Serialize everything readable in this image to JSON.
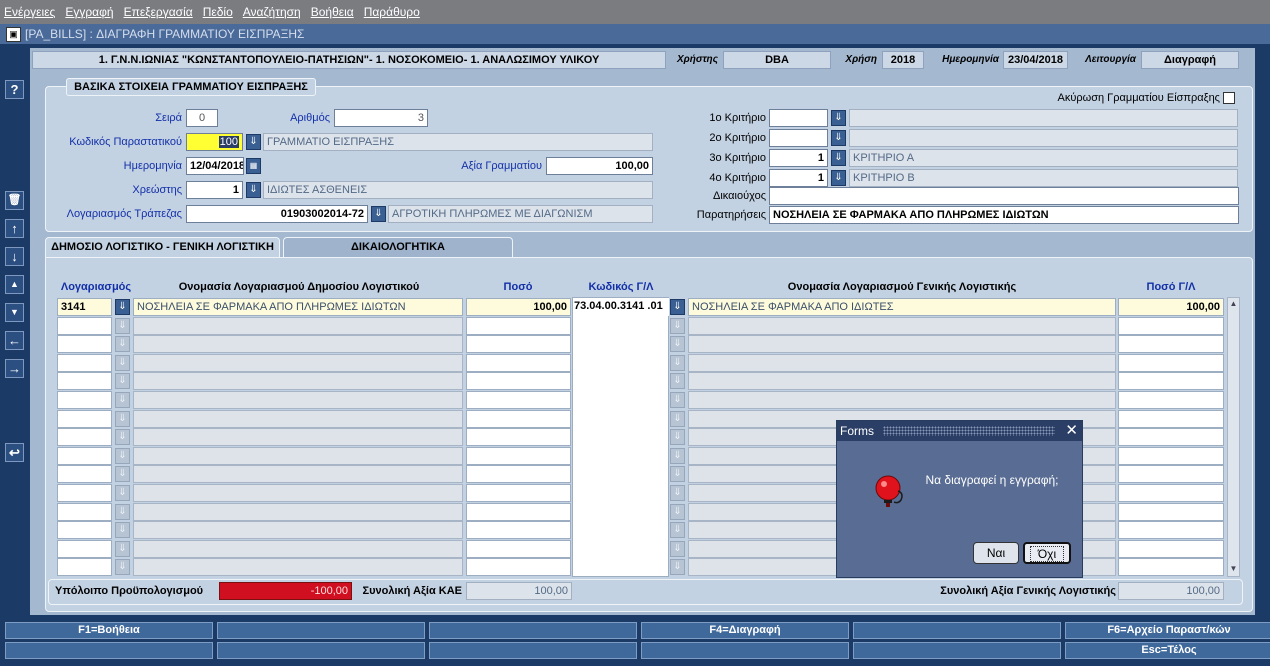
{
  "menu": [
    "Ενέργειες",
    "Εγγραφή",
    "Επεξεργασία",
    "Πεδίο",
    "Αναζήτηση",
    "Βοήθεια",
    "Παράθυρο"
  ],
  "window_title": "[PA_BILLS] : ΔΙΑΓΡΑΦΗ ΓΡΑΜΜΑΤΙΟΥ ΕΙΣΠΡΑΞΗΣ",
  "header": {
    "org": "1. Γ.Ν.Ν.ΙΩΝΙΑΣ \"ΚΩΝΣΤΑΝΤΟΠΟΥΛΕΙΟ-ΠΑΤΗΣΙΩΝ\"- 1. ΝΟΣΟΚΟΜΕΙΟ- 1. ΑΝΑΛΩΣΙΜΟΥ ΥΛΙΚΟΥ",
    "user_label": "Χρήστης",
    "user": "DBA",
    "year_label": "Χρήση",
    "year": "2018",
    "date_label": "Ημερομηνία",
    "date": "23/04/2018",
    "mode_label": "Λειτουργία",
    "mode": "Διαγραφή"
  },
  "basic": {
    "section_title": "ΒΑΣΙΚΑ ΣΤΟΙΧΕΙΑ ΓΡΑΜΜΑΤΙΟΥ ΕΙΣΠΡΑΞΗΣ",
    "cancel_label": "Ακύρωση Γραμματίου Είσπραξης",
    "series_label": "Σειρά",
    "series": "0",
    "number_label": "Αριθμός",
    "number": "3",
    "doc_code_label": "Κωδικός Παραστατικού",
    "doc_code": "100",
    "doc_code_desc": "ΓΡΑΜΜΑΤΙΟ ΕΙΣΠΡΑΞΗΣ",
    "date_label": "Ημερομηνία",
    "date": "12/04/2018",
    "value_label": "Αξία Γραμματίου",
    "value": "100,00",
    "debtor_label": "Χρεώστης",
    "debtor": "1",
    "debtor_desc": "ΙΔΙΩΤΕΣ ΑΣΘΕΝΕΙΣ",
    "bank_label": "Λογαριασμός Τράπεζας",
    "bank": "01903002014-72",
    "bank_desc": "ΑΓΡΟΤΙΚΗ ΠΛΗΡΩΜΕΣ ΜΕ ΔΙΑΓΩΝΙΣΜ",
    "crit1_label": "1ο Κριτήριο",
    "crit1": "",
    "crit1_desc": "",
    "crit2_label": "2ο Κριτήριο",
    "crit2": "",
    "crit2_desc": "",
    "crit3_label": "3ο Κριτήριο",
    "crit3": "1",
    "crit3_desc": "ΚΡΙΤΗΡΙΟ Α",
    "crit4_label": "4ο Κριτήριο",
    "crit4": "1",
    "crit4_desc": "ΚΡΙΤΗΡΙΟ Β",
    "beneficiary_label": "Δικαιούχος",
    "beneficiary": "",
    "notes_label": "Παρατηρήσεις",
    "notes": "ΝΟΣΗΛΕΙΑ  ΣΕ ΦΑΡΜΑΚΑ ΑΠΟ ΠΛΗΡΩΜΕΣ ΙΔΙΩΤΩΝ"
  },
  "tabs": [
    "ΔΗΜΟΣΙΟ ΛΟΓΙΣΤΙΚΟ - ΓΕΝΙΚΗ ΛΟΓΙΣΤΙΚΗ",
    "ΔΙΚΑΙΟΛΟΓΗΤΙΚΑ"
  ],
  "grid": {
    "headers": {
      "account": "Λογαριασμός",
      "account_name": "Ονομασία Λογαριασμού Δημοσίου Λογιστικού",
      "amount": "Ποσό",
      "gl_code": "Κωδικός Γ/Λ",
      "gl_name": "Ονομασία Λογαριασμού Γενικής Λογιστικής",
      "gl_amount": "Ποσό Γ/Λ"
    },
    "rows": [
      {
        "account": "3141",
        "account_name": "ΝΟΣΗΛΕΙΑ  ΣΕ ΦΑΡΜΑΚΑ ΑΠΟ ΠΛΗΡΩΜΕΣ ΙΔΙΩΤΩΝ",
        "amount": "100,00",
        "gl_code": "73.04.00.3141 .01",
        "gl_name": "ΝΟΣΗΛΕΙΑ ΣΕ ΦΑΡΜΑΚΑ ΑΠΟ ΙΔΙΩΤΕΣ",
        "gl_amount": "100,00"
      }
    ],
    "empty_rows": 14
  },
  "footer": {
    "budget_label": "Υπόλοιπο Προϋπολογισμού",
    "budget": "-100,00",
    "kae_label": "Συνολική Αξία ΚΑΕ",
    "kae": "100,00",
    "gl_total_label": "Συνολική Αξία Γενικής Λογιστικής",
    "gl_total": "100,00"
  },
  "fkeys": {
    "row1": [
      "F1=Βοήθεια",
      "",
      "",
      "F4=Διαγραφή",
      "",
      "F6=Αρχείο Παραστ/κών"
    ],
    "row2": [
      "",
      "",
      "",
      "",
      "",
      "Esc=Τέλος"
    ]
  },
  "dialog": {
    "title": "Forms",
    "message": "Να διαγραφεί η εγγραφή;",
    "yes": "Ναι",
    "no": "Όχι"
  },
  "colors": {
    "doc_code_bg": "#ffff33",
    "budget_bg": "#d01020",
    "dialog_bg": "#596d94"
  }
}
